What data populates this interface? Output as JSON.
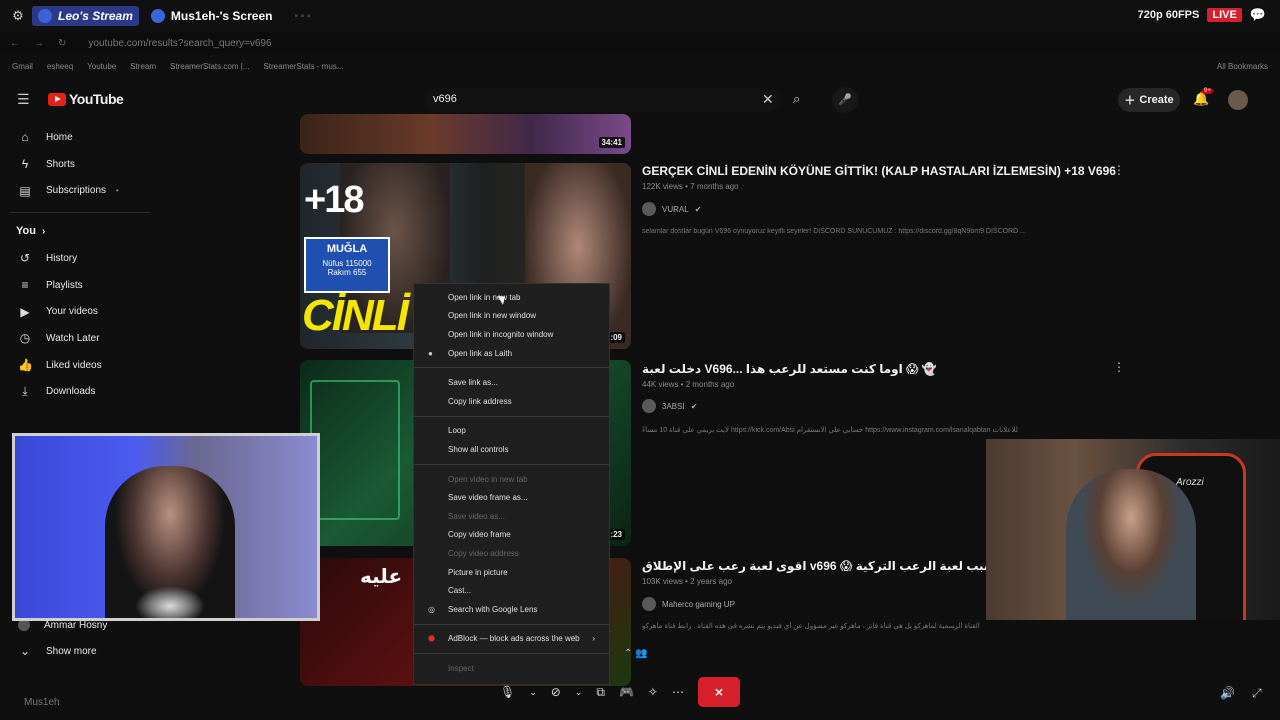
{
  "overlay": {
    "stream_tab": "Leo's Stream",
    "screen_tab": "Mus1eh-'s Screen",
    "quality": "720p 60FPS",
    "live": "LIVE",
    "user_tag": "Mus1eh"
  },
  "browser": {
    "url": "youtube.com/results?search_query=v696",
    "bookmarks": [
      "Gmail",
      "esheeq",
      "Youtube",
      "Stream",
      "StreamerStats.com |...",
      "StreamerStats - mus...",
      "All Bookmarks"
    ]
  },
  "youtube": {
    "logo": "YouTube",
    "search_value": "v696",
    "create_label": "Create",
    "notif_count": "9+",
    "sidebar": {
      "main": [
        {
          "label": "Home",
          "icon": "home-icon"
        },
        {
          "label": "Shorts",
          "icon": "shorts-icon"
        },
        {
          "label": "Subscriptions",
          "icon": "subscriptions-icon"
        }
      ],
      "you_label": "You",
      "you_items": [
        {
          "label": "History",
          "icon": "history-icon"
        },
        {
          "label": "Playlists",
          "icon": "playlists-icon"
        },
        {
          "label": "Your videos",
          "icon": "your-videos-icon"
        },
        {
          "label": "Watch Later",
          "icon": "watch-later-icon"
        },
        {
          "label": "Liked videos",
          "icon": "liked-icon"
        },
        {
          "label": "Downloads",
          "icon": "downloads-icon"
        }
      ],
      "sub_channel": "Ammar Hosny",
      "show_more": "Show more"
    },
    "results": [
      {
        "duration": "34:41"
      },
      {
        "title": "GERÇEK CİNLİ EDENİN KÖYÜNE GİTTİK! (KALP HASTALARI İZLEMESİN) +18 V696",
        "meta": "122K views • 7 months ago",
        "channel": "VURAL",
        "desc": "selamlar dostlar bugün V696 oynuyoruz keyifli seyirler! DISCORD SUNUCUMUZ : https://discord.gg/8qN9bm9 DİSCORD ...",
        "thumb_text_top": "+18",
        "thumb_sign_1": "MUĞLA",
        "thumb_sign_2": "Nüfus 115000",
        "thumb_sign_3": "Rakım 655",
        "thumb_text_bottom": "CİNLİ",
        "duration": ":09"
      },
      {
        "title": "دخلت لعبة V696... اوما كنت مستعد للرعب هذا 😱 👻",
        "meta": "44K views • 2 months ago",
        "channel": "3ABSI",
        "desc": "لايت بريمي على قناة 10 مساءً https://kick.com/Absi حسابي على الانستقرام https://www.instagram.com/lsanalqabtan للاعلانات",
        "duration": ":23"
      },
      {
        "title": "اقوى لعبة رعب على الإطلاق v696 😱 ماهركو يغمى عليه بسبب لعبة الرعب التركية!! 🎃",
        "meta": "103K views • 2 years ago",
        "channel": "Maherco gaming UP",
        "desc": "ملاحظة مهمة: هذه القناة ليست القناة الرسمية لماهركو بل هي قناة فانز ، ماهركو غير مسؤول عن أي فيديو يتم نشره في هذه القناة . رابط قناة ماهركو",
        "thumb_text": "عليه"
      }
    ]
  },
  "context_menu": {
    "group1": [
      "Open link in new tab",
      "Open link in new window",
      "Open link in incognito window",
      "Open link as Laith"
    ],
    "group2": [
      "Save link as...",
      "Copy link address"
    ],
    "group3": [
      "Loop",
      "Show all controls"
    ],
    "group4": [
      {
        "label": "Open video in new tab",
        "disabled": true
      },
      {
        "label": "Save video frame as...",
        "disabled": false
      },
      {
        "label": "Save video as...",
        "disabled": true
      },
      {
        "label": "Copy video frame",
        "disabled": false
      },
      {
        "label": "Copy video address",
        "disabled": true
      },
      {
        "label": "Picture in picture",
        "disabled": false
      },
      {
        "label": "Cast...",
        "disabled": false
      },
      {
        "label": "Search with Google Lens",
        "disabled": false
      }
    ],
    "group5": [
      "AdBlock — block ads across the web"
    ],
    "group6": [
      "Inspect"
    ]
  },
  "webcam_right_brand": "Arozzi",
  "colors": {
    "accent_red": "#d6202b",
    "tab_blue": "#2a3a88",
    "bg": "#0f0f0f"
  }
}
